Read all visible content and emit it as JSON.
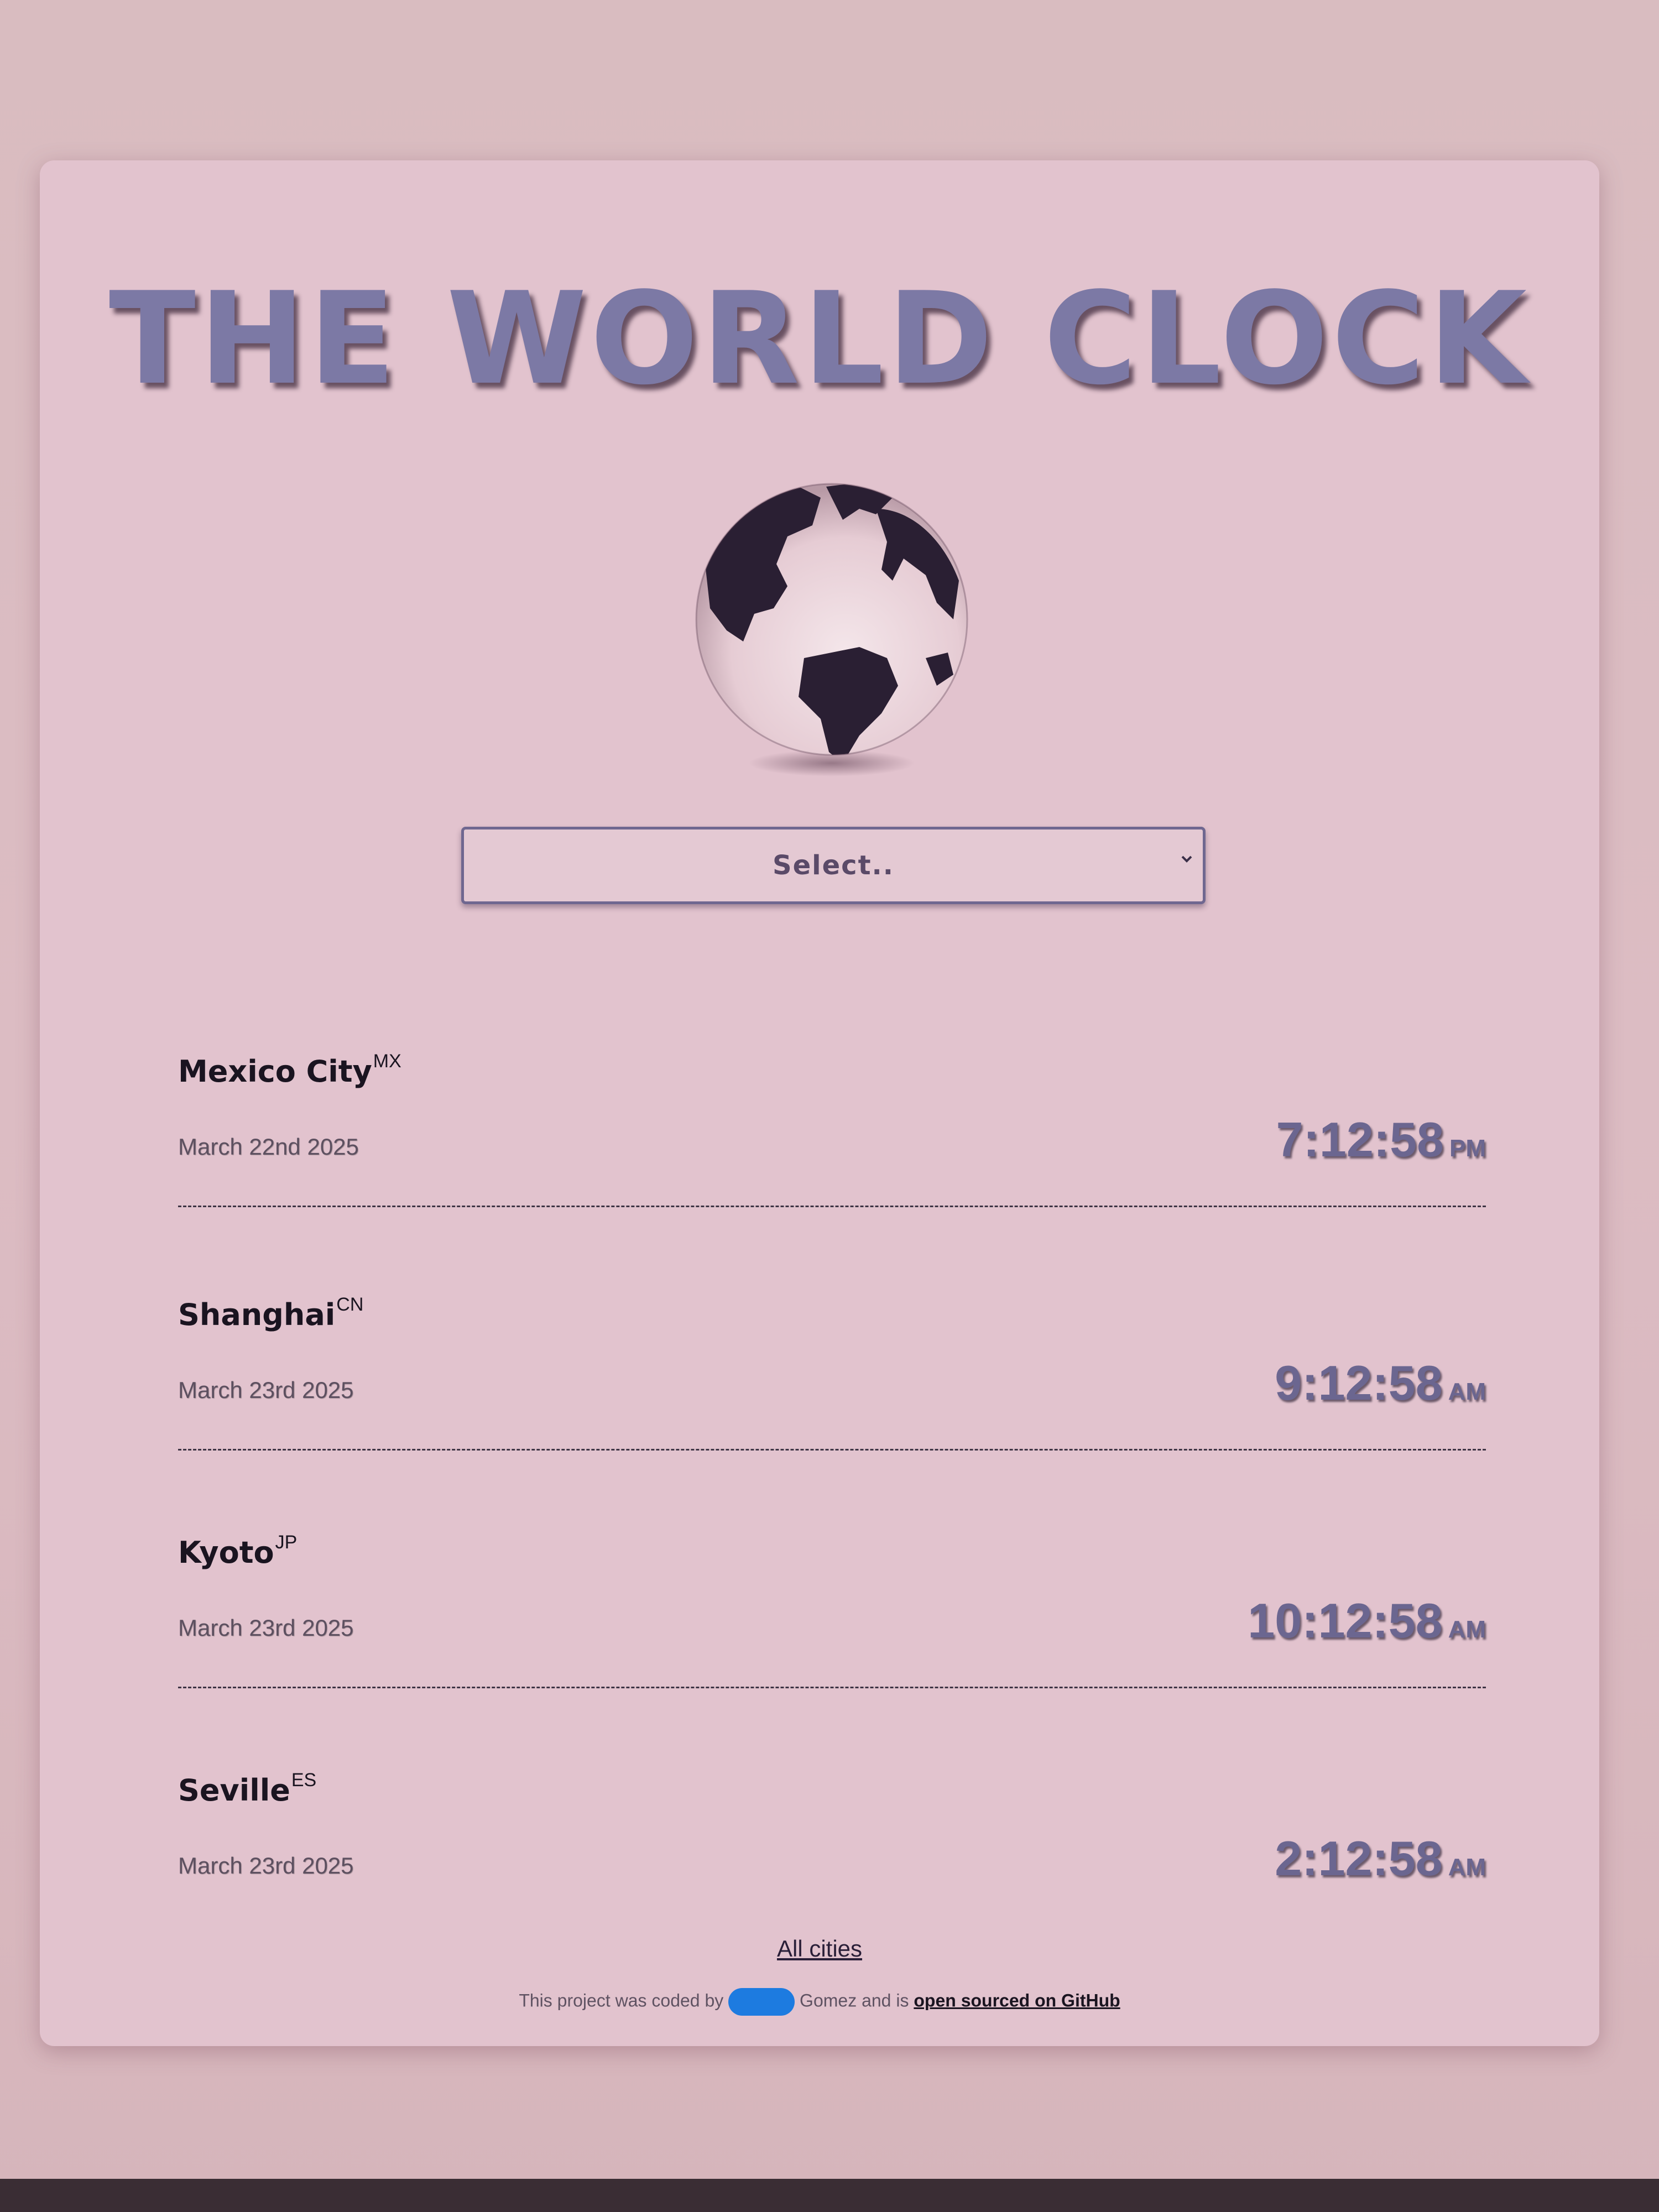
{
  "app": {
    "title": "THE WORLD CLOCK",
    "globe_icon": "globe-icon"
  },
  "select": {
    "label": "Select..",
    "arrow_icon": "chevron-down-icon"
  },
  "cities": [
    {
      "name": "Mexico City",
      "code": "MX",
      "date": "March 22nd 2025",
      "time": "7:12:58",
      "ampm": "PM"
    },
    {
      "name": "Shanghai",
      "code": "CN",
      "date": "March 23rd 2025",
      "time": "9:12:58",
      "ampm": "AM"
    },
    {
      "name": "Kyoto",
      "code": "JP",
      "date": "March 23rd 2025",
      "time": "10:12:58",
      "ampm": "AM"
    },
    {
      "name": "Seville",
      "code": "ES",
      "date": "March 23rd 2025",
      "time": "2:12:58",
      "ampm": "AM"
    }
  ],
  "footer": {
    "all_cities_link": "All cities",
    "credit_prefix": "This project was coded by",
    "credit_name": "Gomez and is",
    "credit_link": "open sourced on GitHub"
  },
  "colors": {
    "background": "#d9bcc0",
    "card": "#e2c3ce",
    "title": "#7c79a5",
    "time": "#6b6690",
    "redaction": "#1d7be0"
  }
}
